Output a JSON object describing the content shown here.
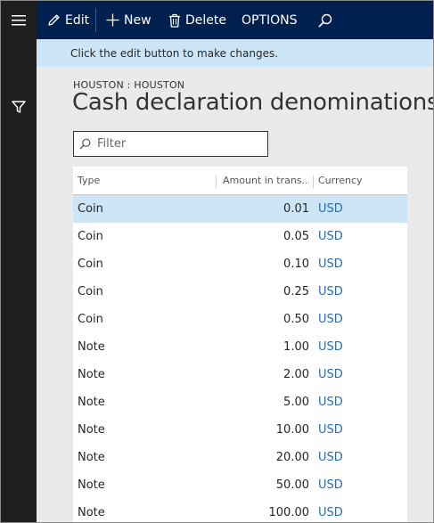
{
  "actions": {
    "edit": "Edit",
    "new": "New",
    "delete": "Delete",
    "options": "OPTIONS"
  },
  "info_message": "Click the edit button to make changes.",
  "breadcrumb": "HOUSTON : HOUSTON",
  "page_title": "Cash declaration denominations",
  "filter": {
    "placeholder": "Filter"
  },
  "grid": {
    "columns": {
      "type": "Type",
      "amount": "Amount in trans...",
      "currency": "Currency"
    },
    "selected_row": 0,
    "rows": [
      {
        "type": "Coin",
        "amount": "0.01",
        "currency": "USD"
      },
      {
        "type": "Coin",
        "amount": "0.05",
        "currency": "USD"
      },
      {
        "type": "Coin",
        "amount": "0.10",
        "currency": "USD"
      },
      {
        "type": "Coin",
        "amount": "0.25",
        "currency": "USD"
      },
      {
        "type": "Coin",
        "amount": "0.50",
        "currency": "USD"
      },
      {
        "type": "Note",
        "amount": "1.00",
        "currency": "USD"
      },
      {
        "type": "Note",
        "amount": "2.00",
        "currency": "USD"
      },
      {
        "type": "Note",
        "amount": "5.00",
        "currency": "USD"
      },
      {
        "type": "Note",
        "amount": "10.00",
        "currency": "USD"
      },
      {
        "type": "Note",
        "amount": "20.00",
        "currency": "USD"
      },
      {
        "type": "Note",
        "amount": "50.00",
        "currency": "USD"
      },
      {
        "type": "Note",
        "amount": "100.00",
        "currency": "USD"
      }
    ]
  },
  "icons": {
    "menu": "hamburger-icon",
    "filter_pane": "funnel-icon",
    "edit": "pencil-icon",
    "new": "plus-icon",
    "delete": "trash-icon",
    "search": "search-icon",
    "filter_field": "search-icon"
  },
  "colors": {
    "nav_dark": "#1f1f1f",
    "action_bar": "#002050",
    "info_bar": "#cde6f7",
    "selected_row": "#cde6f7",
    "link": "#2b6cb3"
  }
}
